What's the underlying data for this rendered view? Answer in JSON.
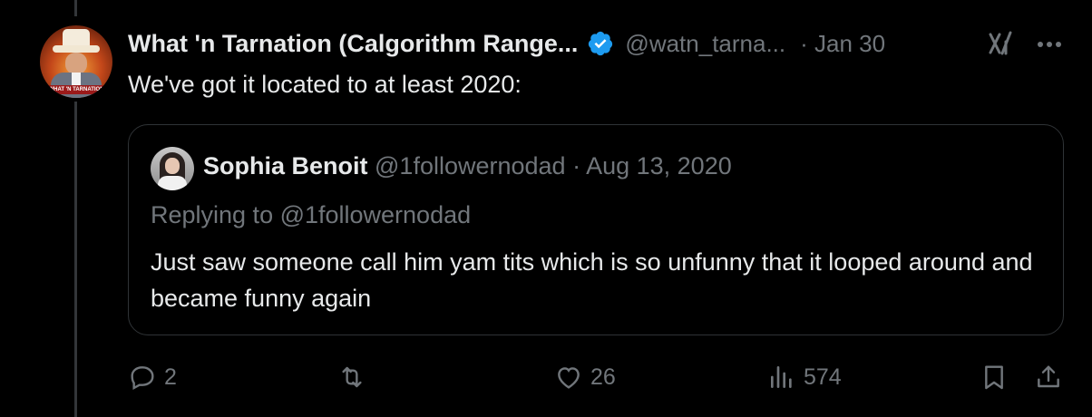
{
  "tweet": {
    "display_name": "What 'n Tarnation (Calgorithm Range...",
    "handle": "@watn_tarna...",
    "date": "· Jan 30",
    "text": "We've got it located to at least 2020:",
    "avatar_banner": "WHAT 'N TARNATION"
  },
  "quote": {
    "name": "Sophia Benoit",
    "handle": "@1followernodad",
    "separator": " · ",
    "date": "Aug 13, 2020",
    "replying_to": "Replying to @1followernodad",
    "text": "Just saw someone call him yam tits which is so unfunny that it looped around and became funny again"
  },
  "actions": {
    "replies": "2",
    "reposts": "",
    "likes": "26",
    "views": "574"
  },
  "icons": {
    "verified": "verified-badge-icon",
    "grok": "grok-icon",
    "more": "more-icon",
    "reply": "reply-icon",
    "repost": "repost-icon",
    "like": "heart-icon",
    "views": "views-icon",
    "bookmark": "bookmark-icon",
    "share": "share-icon"
  },
  "colors": {
    "background": "#000000",
    "text": "#e7e9ea",
    "muted": "#71767b",
    "verified": "#1d9bf0",
    "border": "#2f3336"
  }
}
